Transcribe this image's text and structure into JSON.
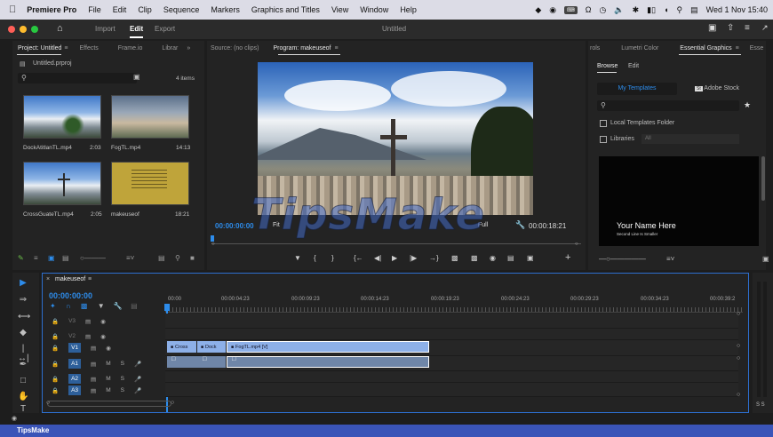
{
  "menubar": {
    "apple": "",
    "app": "Premiere Pro",
    "items": [
      "File",
      "Edit",
      "Clip",
      "Sequence",
      "Markers",
      "Graphics and Titles",
      "View",
      "Window",
      "Help"
    ],
    "clock": "Wed 1 Nov 15:40"
  },
  "titlebar": {
    "import": "Import",
    "edit": "Edit",
    "export": "Export",
    "title": "Untitled"
  },
  "project": {
    "tabs": [
      "Project: Untitled",
      "Effects",
      "Frame.io",
      "Librar"
    ],
    "file": "Untitled.prproj",
    "count": "4 items",
    "clips": [
      {
        "name": "DockAtitlanTL.mp4",
        "dur": "2:03"
      },
      {
        "name": "FogTL.mp4",
        "dur": "14:13"
      },
      {
        "name": "CrossGuateTL.mp4",
        "dur": "2:05"
      },
      {
        "name": "makeuseof",
        "dur": "18:21"
      }
    ]
  },
  "monitor": {
    "source_tab": "Source: (no clips)",
    "program_tab": "Program: makeuseof",
    "timecode": "00:00:00:00",
    "fit": "Fit",
    "full": "Full",
    "duration": "00:00:18:21"
  },
  "essential": {
    "tabs": [
      "rols",
      "Lumetri Color",
      "Essential Graphics",
      "Esse"
    ],
    "browse": "Browse",
    "edit": "Edit",
    "my_templates": "My Templates",
    "adobe_stock": "Adobe Stock",
    "local_folder": "Local Templates Folder",
    "libraries": "Libraries",
    "libraries_val": "All",
    "template_title": "Your Name Here",
    "template_sub": "Second Line Is Smaller"
  },
  "timeline": {
    "tab": "makeuseof",
    "timecode": "00:00:00:00",
    "ruler": [
      "00:00",
      "00:00:04:23",
      "00:00:09:23",
      "00:00:14:23",
      "00:00:19:23",
      "00:00:24:23",
      "00:00:29:23",
      "00:00:34:23",
      "00:00:39:2"
    ],
    "video_tracks": [
      "V3",
      "V2",
      "V1"
    ],
    "audio_tracks": [
      "A1",
      "A2",
      "A3"
    ],
    "clips": [
      "Cross",
      "Dock",
      "FogTL.mp4 [V]"
    ]
  },
  "watermark": "TipsMake",
  "footer": "TipsMake",
  "colors": {
    "accent": "#2d8ceb",
    "blue_clip": "#8db0e8",
    "audio_clip": "#6f86a8",
    "bottom_bar": "#3a54b8"
  }
}
